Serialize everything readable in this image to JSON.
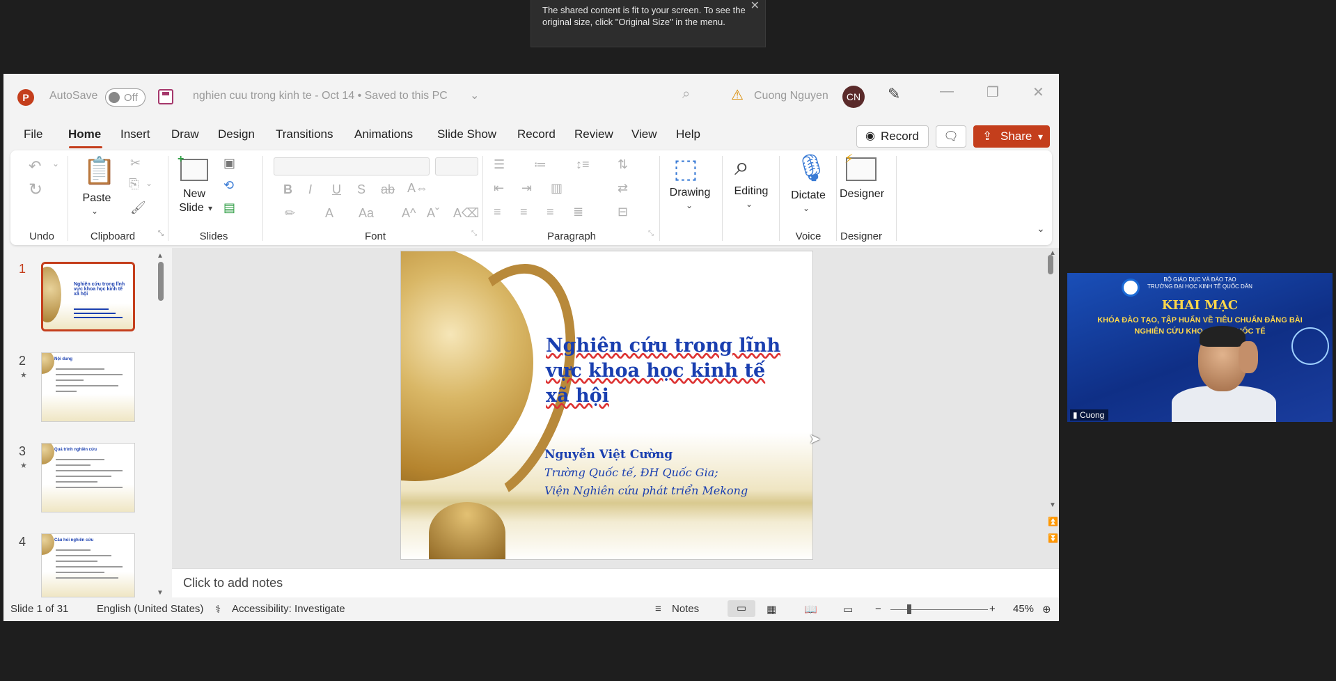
{
  "toast": {
    "message": "The shared content is fit to your screen. To see the original size, click \"Original Size\" in the menu."
  },
  "titlebar": {
    "autosave_label": "AutoSave",
    "autosave_state": "Off",
    "document_title": "nghien cuu trong kinh te - Oct 14 • Saved to this PC",
    "user_name": "Cuong Nguyen",
    "user_initials": "CN"
  },
  "menu": {
    "tabs": [
      "File",
      "Home",
      "Insert",
      "Draw",
      "Design",
      "Transitions",
      "Animations",
      "Slide Show",
      "Record",
      "Review",
      "View",
      "Help"
    ],
    "record_button": "Record",
    "share_button": "Share"
  },
  "ribbon": {
    "paste": "Paste",
    "new_slide_1": "New",
    "new_slide_2": "Slide",
    "drawing": "Drawing",
    "editing": "Editing",
    "dictate": "Dictate",
    "designer": "Designer",
    "groups": {
      "undo": "Undo",
      "clipboard": "Clipboard",
      "slides": "Slides",
      "font": "Font",
      "paragraph": "Paragraph",
      "voice": "Voice",
      "designer": "Designer"
    }
  },
  "thumbnails": [
    {
      "num": "1",
      "title": "Nghiên cứu trong lĩnh vực khoa học kinh tế xã hội"
    },
    {
      "num": "2",
      "title": "Nội dung"
    },
    {
      "num": "3",
      "title": "Quá trình nghiên cứu"
    },
    {
      "num": "4",
      "title": "Câu hỏi nghiên cứu"
    }
  ],
  "slide": {
    "title_line1": "Nghiên cứu trong lĩnh",
    "title_line2": "vực khoa học kinh tế",
    "title_line3": "xã hội",
    "author": "Nguyễn Việt Cường",
    "affiliation1": "Trường Quốc tế, ĐH Quốc Gia;",
    "affiliation2": "Viện Nghiên cứu phát triển Mekong"
  },
  "notes": {
    "placeholder": "Click to add notes"
  },
  "status": {
    "slide_count": "Slide 1 of 31",
    "language": "English (United States)",
    "accessibility": "Accessibility: Investigate",
    "notes": "Notes",
    "zoom": "45%"
  },
  "video": {
    "header_line1": "BỘ GIÁO DỤC VÀ ĐÀO TẠO",
    "header_line2": "TRƯỜNG ĐẠI HỌC KINH TẾ QUỐC DÂN",
    "title": "KHAI MẠC",
    "sub1": "KHÓA ĐÀO TẠO, TẬP HUẤN VỀ TIÊU CHUẨN ĐĂNG BÀI",
    "sub2": "NGHIÊN CỨU KHO...  BÁO QUỐC TẾ",
    "participant": "Cuong"
  },
  "colors": {
    "accent": "#c43e1c",
    "slide_text": "#1a3fb0"
  }
}
